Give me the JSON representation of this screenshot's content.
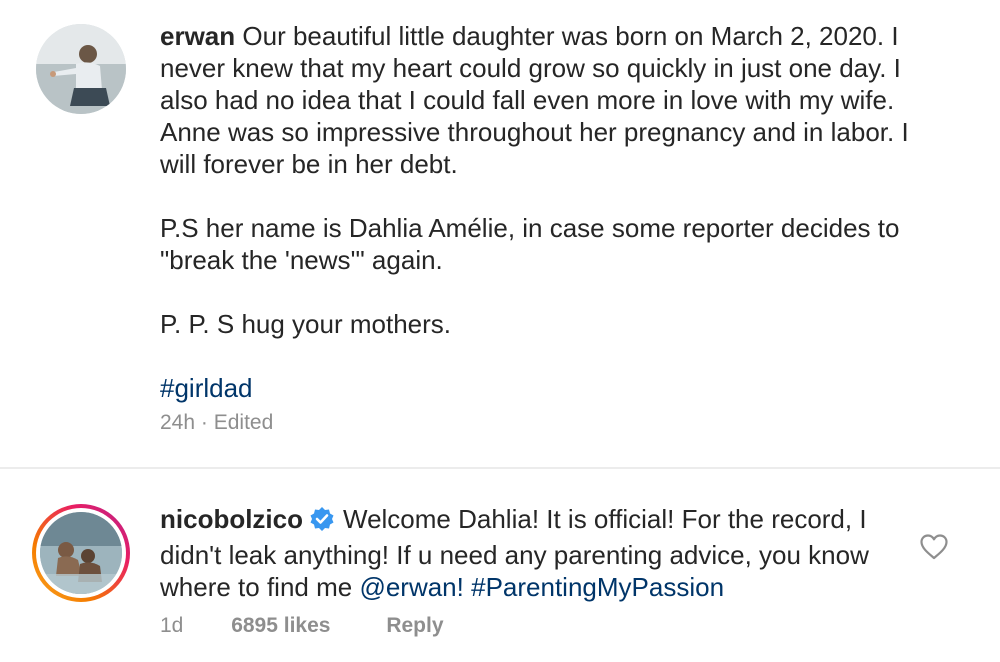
{
  "comment1": {
    "username": "erwan",
    "text_lines": [
      "Our beautiful little daughter was born on March 2, 2020. I never knew that my heart could grow so quickly in just one day. I also had no idea that I could fall even more in love with my wife. Anne was so impressive throughout her pregnancy and in labor. I will forever be in her debt.",
      "P.S her name is Dahlia Amélie, in case some reporter decides to \"break the 'news'\" again.",
      "P. P. S hug your mothers.",
      "#girldad"
    ],
    "timestamp": "24h",
    "separator": "·",
    "edited": "Edited",
    "avatar_icon": "profile-photo-icon"
  },
  "comment2": {
    "username": "nicobolzico",
    "verified_icon": "verified-badge-icon",
    "text": "Welcome Dahlia! It is official! For the record, I didn't leak anything! If u need any parenting advice, you know where to find me ",
    "mention": "@erwan!",
    "hashtag": "#ParentingMyPassion",
    "timestamp": "1d",
    "likes": "6895 likes",
    "reply_label": "Reply",
    "like_icon": "heart-outline-icon",
    "avatar_icon": "profile-photo-icon"
  },
  "colors": {
    "text": "#262626",
    "muted": "#8e8e8e",
    "link": "#003569",
    "verified": "#3897f0",
    "divider": "#ececec"
  }
}
